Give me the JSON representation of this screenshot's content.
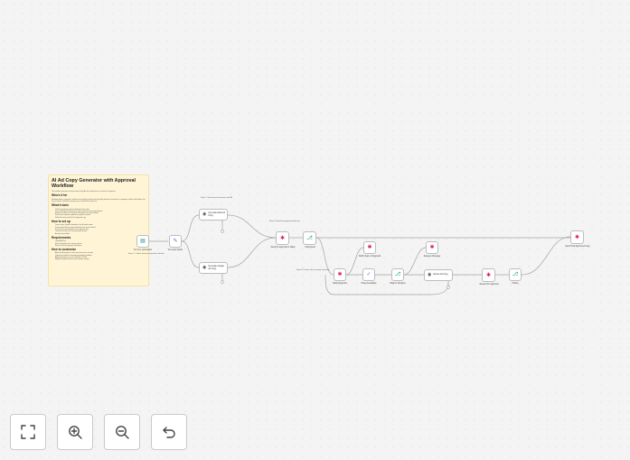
{
  "note": {
    "title": "AI Ad Copy Generator with Approval Workflow",
    "intro": "This workflow generates ad copy variants using AI, then sends them to a reviewer for approval.",
    "whos_for_heading": "Who's it for",
    "whos_for_text": "Marketing teams, copywriters, freelancers and agencies who need to quickly generate ad variants for campaigns on Meta and Google, and want a human in the loop reviewing every variant before it goes live.",
    "what_heading": "What it does",
    "what_items": [
      "Collects brand and product information from a form",
      "Uses an AI agent to generate ad copy variants for each target platform",
      "Sends the variants to a reviewer with approve and reject buttons",
      "Routes the response to publish or request a revision",
      "Notifies the team with the final approved copy"
    ],
    "setup_heading": "How to set up",
    "setup_items": [
      "Connect your OpenAI credentials in the AI model nodes",
      "Connect your Slack account and choose the review channel",
      "Set up the email credentials for the approval step",
      "Test the form and check the generated variants",
      "Activate the workflow"
    ],
    "req_heading": "Requirements",
    "req_items": [
      "OpenAI API key",
      "Slack workspace with a review channel",
      "Email account for approval notifications"
    ],
    "customize_heading": "How to customize",
    "customize_items": [
      "Adjust the AI prompt to match your brand voice and tone",
      "Change the number of variants generated per platform",
      "Add more platforms such as LinkedIn or TikTok",
      "Modify the approval timeout and reminder settings"
    ]
  },
  "stickies": [
    "Step 1: Collect brand and product details",
    "Step 2: Generate ad variants with AI",
    "Step 3: Send for approval and wait",
    "Step 4: Process the reviewer decision"
  ],
  "nodes": {
    "form_trigger": {
      "label": "On form submission",
      "icon": "form-trigger-icon"
    },
    "set_input": {
      "label": "Set Input Fields",
      "icon": "edit-fields-icon"
    },
    "meta_agent": {
      "title": "Generate Meta Ad Copy",
      "sub": "AI Agent",
      "icon": "ai-agent-icon"
    },
    "google_agent": {
      "title": "Generate Google Ad Copy",
      "sub": "AI Agent",
      "icon": "ai-agent-icon"
    },
    "merge": {
      "label": "Merge Variants",
      "icon": "merge-icon"
    },
    "slack_send": {
      "label": "Send for Approval in Slack",
      "icon": "slack-icon"
    },
    "if_approved": {
      "label": "If Approved",
      "icon": "if-icon"
    },
    "slack_notify": {
      "label": "Notify Team of Approval",
      "icon": "slack-icon"
    },
    "slack_rejected": {
      "label": "Notify Rejection",
      "icon": "slack-icon"
    },
    "code_parse": {
      "label": "Parse Feedback",
      "icon": "code-icon"
    },
    "wait": {
      "label": "Wait for Revision",
      "icon": "wait-icon"
    },
    "revise_agent": {
      "title": "Revise Ad Copy",
      "sub": "AI Agent",
      "icon": "ai-agent-icon"
    },
    "slack_request": {
      "label": "Request Changes",
      "icon": "slack-icon"
    },
    "slack_resend": {
      "label": "Resend for Approval",
      "icon": "slack-icon"
    },
    "if_retry": {
      "label": "If Retry",
      "icon": "if-icon"
    },
    "slack_final": {
      "label": "Send Final Approved Copy",
      "icon": "slack-icon"
    }
  },
  "toolbar": {
    "fit_view": "fit-view-icon",
    "zoom_in": "zoom-in-icon",
    "zoom_out": "zoom-out-icon",
    "reset": "undo-icon"
  },
  "colors": {
    "canvas": "#f4f4f4",
    "note_bg": "#fff5d6",
    "connector": "#9e9e9e",
    "slack": "#e01e5a",
    "if_green": "#1aa36c"
  }
}
